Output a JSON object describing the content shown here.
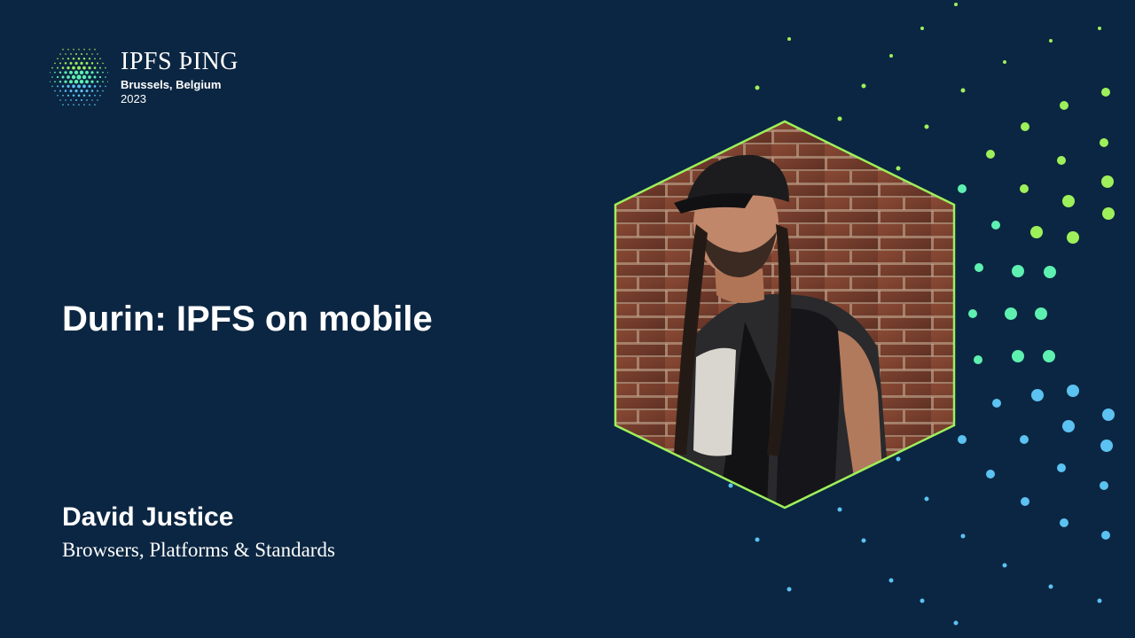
{
  "event": {
    "name": "IPFS ÞING",
    "location": "Brussels, Belgium",
    "year": "2023"
  },
  "talk": {
    "title": "Durin: IPFS on mobile"
  },
  "speaker": {
    "name": "David Justice",
    "track": "Browsers, Platforms & Standards"
  },
  "colors": {
    "background": "#0b2642",
    "accent_green": "#9ef05a",
    "accent_teal": "#5ef0b0",
    "accent_blue": "#5bc2f2",
    "text": "#ffffff"
  },
  "icons": {
    "logo": "ipfs-thing-hexagon-dots-logo",
    "photo": "speaker-portrait-hexagon"
  }
}
